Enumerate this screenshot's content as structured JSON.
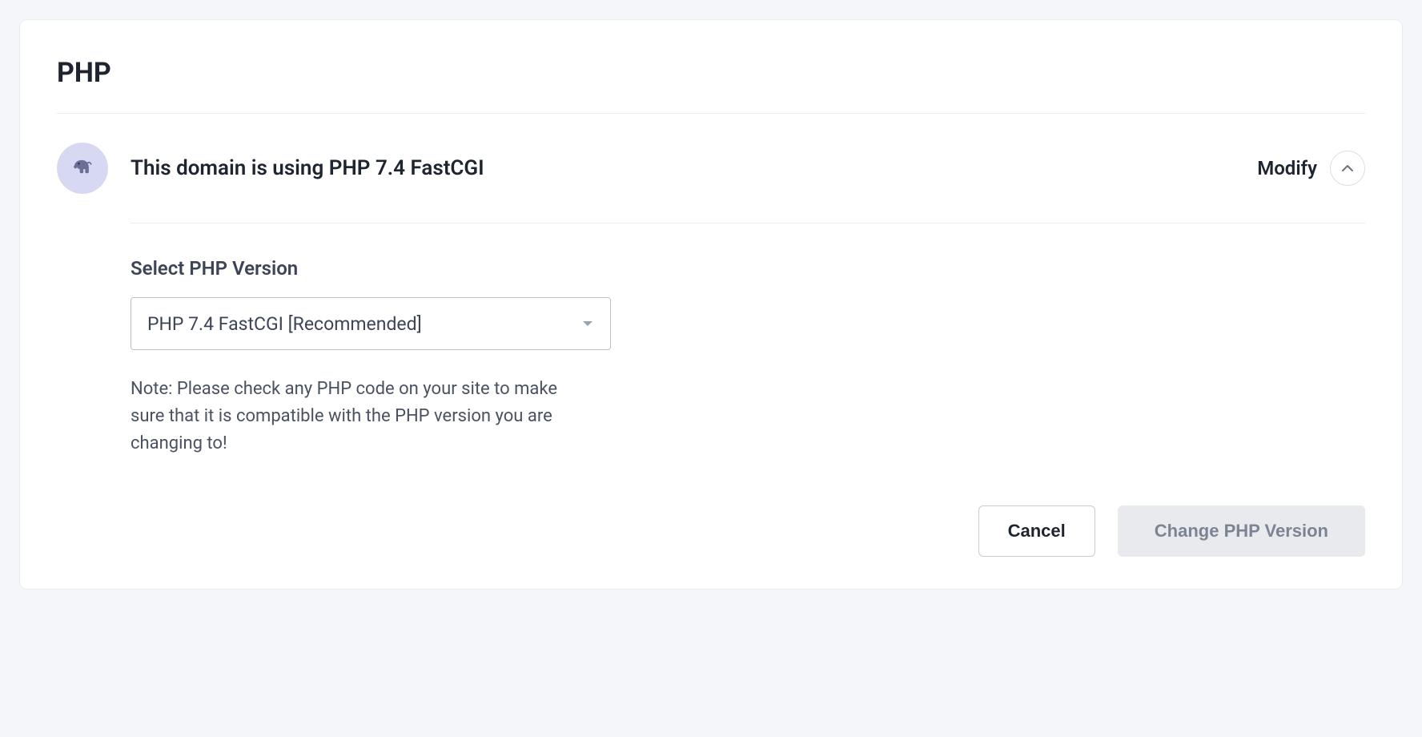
{
  "card": {
    "title": "PHP"
  },
  "section": {
    "icon_name": "elephant-icon",
    "summary": "This domain is using PHP 7.4 FastCGI",
    "modify_label": "Modify"
  },
  "form": {
    "select_label": "Select PHP Version",
    "select_value": "PHP 7.4 FastCGI [Recommended]",
    "note": "Note: Please check any PHP code on your site to make sure that it is compatible with the PHP version you are changing to!"
  },
  "actions": {
    "cancel_label": "Cancel",
    "submit_label": "Change PHP Version"
  }
}
